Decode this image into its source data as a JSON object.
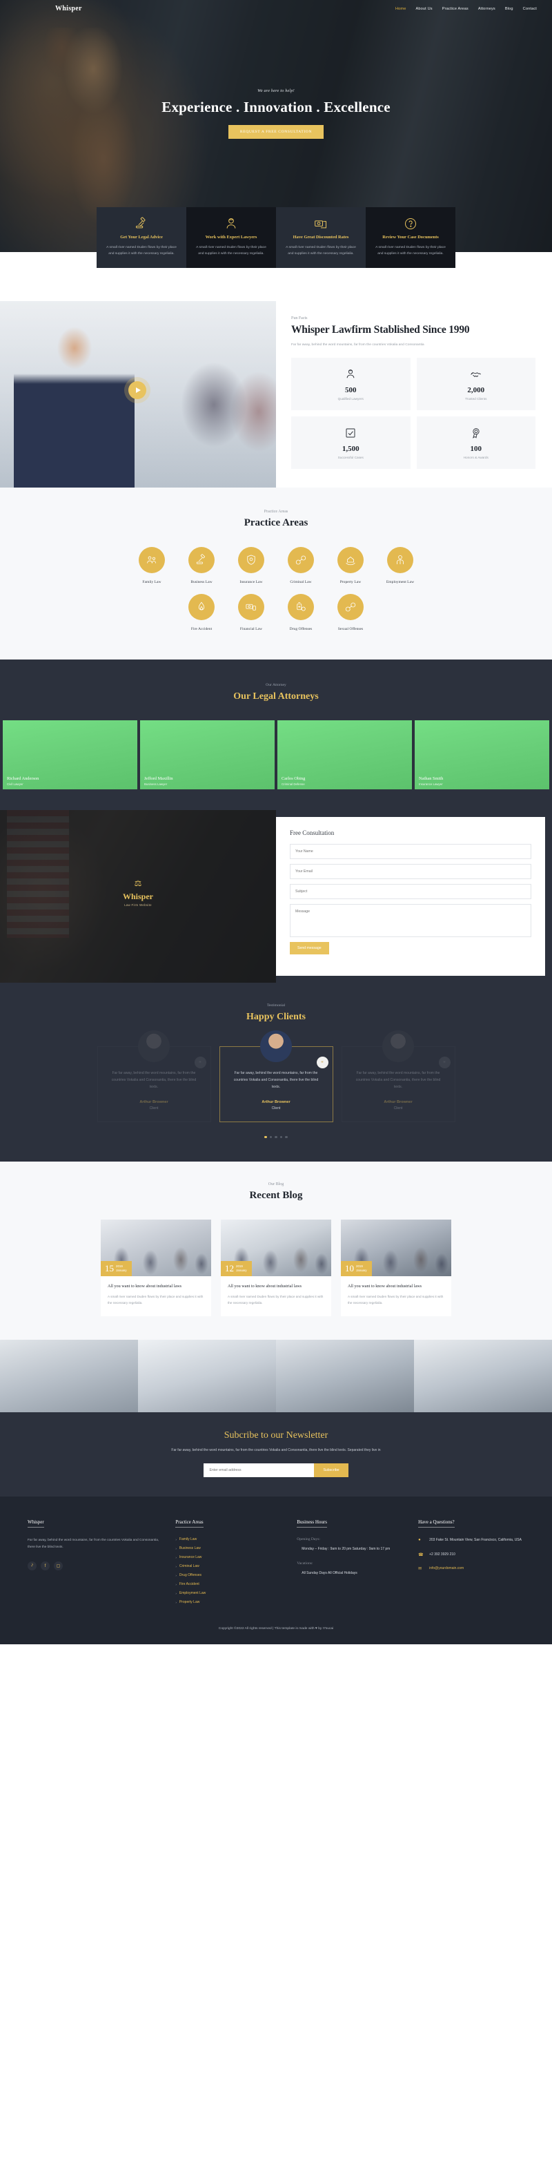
{
  "header": {
    "brand": "Whisper",
    "nav": [
      {
        "label": "Home",
        "active": true
      },
      {
        "label": "About Us",
        "active": false
      },
      {
        "label": "Practice Areas",
        "active": false
      },
      {
        "label": "Attorneys",
        "active": false
      },
      {
        "label": "Blog",
        "active": false
      },
      {
        "label": "Contact",
        "active": false
      }
    ]
  },
  "hero": {
    "kicker": "We are here to help!",
    "title": "Experience . Innovation . Excellence",
    "cta": "REQUEST A FREE CONSULTATION"
  },
  "features": [
    {
      "icon": "gavel-icon",
      "title": "Get Your Legal Advice",
      "text": "A small river named Duden flows by their place and supplies it with the necessary regelialia."
    },
    {
      "icon": "lawyer-icon",
      "title": "Work with Expert Lawyers",
      "text": "A small river named Duden flows by their place and supplies it with the necessary regelialia."
    },
    {
      "icon": "money-icon",
      "title": "Have Great Discounted Rates",
      "text": "A small river named Duden flows by their place and supplies it with the necessary regelialia."
    },
    {
      "icon": "question-icon",
      "title": "Review Your Case Documents",
      "text": "A small river named Duden flows by their place and supplies it with the necessary regelialia."
    }
  ],
  "about": {
    "kicker": "Fun Facts",
    "title": "Whisper Lawfirm Stablished Since 1990",
    "subtitle": "Far far away, behind the word mountains, far from the countries Vokalia and Consonantia",
    "facts": [
      {
        "icon": "lawyer-icon",
        "number": "500",
        "label": "Qualified Lawyers"
      },
      {
        "icon": "handshake-icon",
        "number": "2,000",
        "label": "Trusted Clients"
      },
      {
        "icon": "checkbox-icon",
        "number": "1,500",
        "label": "Successful Cases"
      },
      {
        "icon": "award-icon",
        "number": "100",
        "label": "Honors & Awards"
      }
    ]
  },
  "practice": {
    "kicker": "Practice Areas",
    "title": "Practice Areas",
    "row1": [
      {
        "icon": "family-icon",
        "label": "Family Law"
      },
      {
        "icon": "gavel-icon",
        "label": "Business Law"
      },
      {
        "icon": "shield-icon",
        "label": "Insurance Law"
      },
      {
        "icon": "handcuffs-icon",
        "label": "Criminal Law"
      },
      {
        "icon": "house-hand-icon",
        "label": "Property Law"
      },
      {
        "icon": "employee-icon",
        "label": "Employment Law"
      }
    ],
    "row2": [
      {
        "icon": "fire-icon",
        "label": "Fire Accident"
      },
      {
        "icon": "money-icon",
        "label": "Financial Law"
      },
      {
        "icon": "pills-icon",
        "label": "Drug Offenses"
      },
      {
        "icon": "handcuffs-icon",
        "label": "Sexual Offenses"
      }
    ]
  },
  "attorneys": {
    "kicker": "Our Attorney",
    "title": "Our Legal Attorneys",
    "members": [
      {
        "name": "Richard Anderson",
        "role": "Civil Lawyer"
      },
      {
        "name": "Jefford Maxillin",
        "role": "Business Lawyer"
      },
      {
        "name": "Carlos Obing",
        "role": "Criminal Defense"
      },
      {
        "name": "Nathan Smith",
        "role": "Insurance Lawyer"
      }
    ]
  },
  "consultation": {
    "logo_name": "Whisper",
    "logo_tag": "Law Firm Website",
    "form_title": "Free Consultation",
    "name_placeholder": "Your Name",
    "email_placeholder": "Your Email",
    "subject_placeholder": "Subject",
    "message_placeholder": "Message",
    "send_label": "Send message"
  },
  "testimonials": {
    "kicker": "Testimonial",
    "title": "Happy Clients",
    "items": [
      {
        "text": "Far far away, behind the word mountains, far from the countries Vokalia and Consonantia, there live the blind texts.",
        "name": "Arthur Browner",
        "role": "Client"
      },
      {
        "text": "Far far away, behind the word mountains, far from the countries Vokalia and Consonantia, there live the blind texts.",
        "name": "Arthur Browner",
        "role": "Client"
      },
      {
        "text": "Far far away, behind the word mountains, far from the countries Vokalia and Consonantia, there live the blind texts.",
        "name": "Arthur Browner",
        "role": "Client"
      }
    ],
    "dots": 5,
    "active_dot": 0
  },
  "blog": {
    "kicker": "Our Blog",
    "title": "Recent Blog",
    "posts": [
      {
        "day": "15",
        "year": "2019",
        "month": "January",
        "title": "All you want to know about industrial laws",
        "text": "A small river named Duden flows by their place and supplies it with the necessary regelialia."
      },
      {
        "day": "12",
        "year": "2019",
        "month": "January",
        "title": "All you want to know about industrial laws",
        "text": "A small river named Duden flows by their place and supplies it with the necessary regelialia."
      },
      {
        "day": "10",
        "year": "2019",
        "month": "January",
        "title": "All you want to know about industrial laws",
        "text": "A small river named Duden flows by their place and supplies it with the necessary regelialia."
      }
    ]
  },
  "newsletter": {
    "title": "Subcribe to our Newsletter",
    "subtitle": "Far far away, behind the word mountains, far from the countries Vokalia and Consonantia, there live the blind texts. Separated they live in",
    "placeholder": "Enter email address",
    "button": "Subscribe"
  },
  "footer": {
    "col1": {
      "title": "Whisper",
      "text": "Far far away, behind the word mountains, far from the countries Vokalia and Consonantia, there live the blind texts.",
      "social": [
        {
          "icon": "twitter-icon",
          "glyph": "ᵗ"
        },
        {
          "icon": "facebook-icon",
          "glyph": "f"
        },
        {
          "icon": "instagram-icon",
          "glyph": "□"
        }
      ]
    },
    "col2": {
      "title": "Practice Areas",
      "links": [
        "Family Law",
        "Business Law",
        "Insurance Law",
        "Criminal Law",
        "Drug Offenses",
        "Fire Accident",
        "Employment Law",
        "Property Law"
      ]
    },
    "col3": {
      "title": "Business Hours",
      "opening_label": "Opening Days:",
      "opening_value": "Monday – Friday : 9am to 20 pm Saturday : 9am to 17 pm",
      "vacations_label": "Vacations:",
      "vacations_value": "All Sunday Days All Official Holidays"
    },
    "col4": {
      "title": "Have a Questions?",
      "address": "203 Fake St. Mountain View, San Francisco, California, USA",
      "phone": "+2 392 3929 210",
      "email": "info@yourdomain.com"
    },
    "copyright": "Copyright ©2022 All rights reserved | This template is made with ♥ by I7sucai"
  },
  "colors": {
    "gold": "#e3b950",
    "gold_light": "#e8c35e",
    "dark": "#2c313d",
    "darker": "#212630"
  }
}
